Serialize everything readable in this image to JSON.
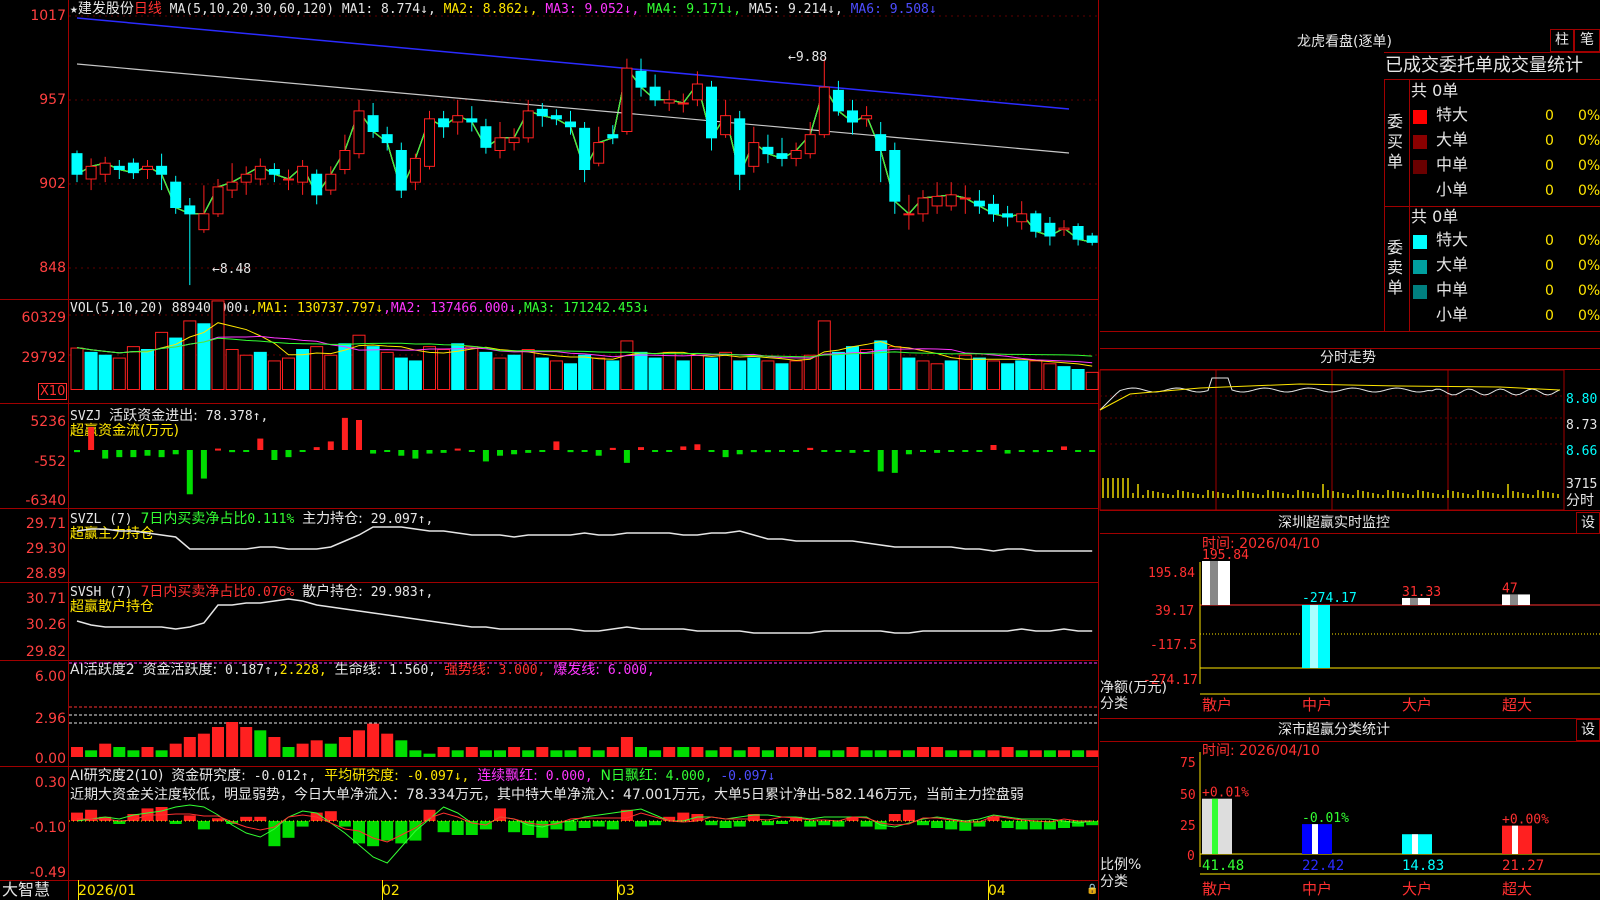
{
  "header": {
    "star": "★",
    "stock": "建发股份",
    "period": "日线",
    "ma_title": "MA(5,10,20,30,60,120)",
    "ma": [
      {
        "label": "MA1:",
        "value": "8.774↓",
        "color": "#e6e6e6"
      },
      {
        "label": "MA2:",
        "value": "8.862↓",
        "color": "#ffe600"
      },
      {
        "label": "MA3:",
        "value": "9.052↓",
        "color": "#ff36ff"
      },
      {
        "label": "MA4:",
        "value": "9.171↓",
        "color": "#33ff33"
      },
      {
        "label": "MA5:",
        "value": "9.214↓",
        "color": "#e6e6e6"
      },
      {
        "label": "MA6:",
        "value": "9.508↓",
        "color": "#4d4dff"
      }
    ]
  },
  "price_axis": [
    "1017",
    "957",
    "902",
    "848"
  ],
  "annotations": {
    "high": "9.88",
    "low": "8.48"
  },
  "vol": {
    "title": "VOL(5,10,20)",
    "value": "88940.000↓",
    "ma": [
      {
        "label": "MA1:",
        "value": "130737.797↓"
      },
      {
        "label": "MA2:",
        "value": "137466.000↓"
      },
      {
        "label": "MA3:",
        "value": "171242.453↓"
      }
    ],
    "axis": [
      "60329",
      "29792"
    ],
    "unit": "X10"
  },
  "svzj": {
    "title": "SVZJ",
    "label": "活跃资金进出:",
    "value": "78.378↑,",
    "sub": "超赢资金流(万元)",
    "axis": [
      "5236",
      "-552",
      "-6340"
    ]
  },
  "svzl": {
    "title": "SVZL (7)",
    "pct_label": "7日内买卖净占比",
    "pct_value": "0.111%",
    "hold_label": "主力持仓:",
    "hold_value": "29.097↑,",
    "sub": "超赢主力持仓",
    "axis": [
      "29.71",
      "29.30",
      "28.89"
    ]
  },
  "svsh": {
    "title": "SVSH (7)",
    "pct_label": "7日内买卖净占比",
    "pct_value": "0.076%",
    "hold_label": "散户持仓:",
    "hold_value": "29.983↑,",
    "sub": "超赢散户持仓",
    "axis": [
      "30.71",
      "30.26",
      "29.82"
    ]
  },
  "ai1": {
    "title": "AI活跃度2",
    "l1": "资金活跃度:",
    "v1": "0.187↑,",
    "v2": "2.228,",
    "l3": "生命线:",
    "v3": "1.560,",
    "l4": "强势线:",
    "v4": "3.000,",
    "l5": "爆发线:",
    "v5": "6.000,",
    "axis": [
      "6.00",
      "2.96",
      "0.00"
    ]
  },
  "ai2": {
    "title": "AI研究度2(10)",
    "l1": "资金研究度:",
    "v1": "-0.012↑,",
    "l2": "平均研究度:",
    "v2": "-0.097↓,",
    "l3": "连续飘红:",
    "v3": "0.000,",
    "l4": "N日飘红:",
    "v4": "4.000,",
    "v5": "-0.097↓",
    "note": "近期大资金关注度较低，明显弱势，今日大单净流入：78.334万元，其中特大单净流入：47.001万元，大单5日累计净出-582.146万元，当前主力控盘弱",
    "axis": [
      "0.30",
      "-0.10",
      "-0.49"
    ]
  },
  "xaxis": [
    "2026/01",
    "02",
    "03",
    "04"
  ],
  "brand": "大智慧",
  "right": {
    "dragon": {
      "title": "龙虎看盘(逐单)",
      "btn1": "柱",
      "btn2": "笔",
      "tabs": "已成交委托单成交量统计",
      "buy": {
        "side": "委买单",
        "total": "共 0单",
        "rows": [
          {
            "label": "特大",
            "count": "0",
            "pct": "0%",
            "color": "#ff0000"
          },
          {
            "label": "大单",
            "count": "0",
            "pct": "0%",
            "color": "#8a0000"
          },
          {
            "label": "中单",
            "count": "0",
            "pct": "0%",
            "color": "#6a0000"
          },
          {
            "label": "小单",
            "count": "0",
            "pct": "0%",
            "color": ""
          }
        ]
      },
      "sell": {
        "side": "委卖单",
        "total": "共 0单",
        "rows": [
          {
            "label": "特大",
            "count": "0",
            "pct": "0%",
            "color": "#00ffff"
          },
          {
            "label": "大单",
            "count": "0",
            "pct": "0%",
            "color": "#00a0a0"
          },
          {
            "label": "中单",
            "count": "0",
            "pct": "0%",
            "color": "#008080"
          },
          {
            "label": "小单",
            "count": "0",
            "pct": "0%",
            "color": ""
          }
        ]
      }
    },
    "intraday": {
      "title": "分时走势",
      "axis": [
        "8.80",
        "8.73",
        "8.66"
      ],
      "vol_label": "3715",
      "fen": "分时"
    },
    "monitor": {
      "title": "深圳超赢实时监控",
      "btn": "设",
      "time": "时间: 2026/04/10",
      "axis": [
        "195.84",
        "39.17",
        "-117.5",
        "-274.17"
      ],
      "ylabel1": "净额(万元)",
      "ylabel2": "分类",
      "bars": [
        {
          "label": "散户",
          "value": "195.84"
        },
        {
          "label": "中户",
          "value": "-274.17"
        },
        {
          "label": "大户",
          "value": "31.33"
        },
        {
          "label": "超大",
          "value": "47"
        }
      ]
    },
    "classify": {
      "title": "深市超赢分类统计",
      "btn": "设",
      "time": "时间: 2026/04/10",
      "axis": [
        "75",
        "50",
        "25",
        "0"
      ],
      "ylabel1": "比例%",
      "ylabel2": "分类",
      "bars": [
        {
          "label": "散户",
          "value": "41.48",
          "pct": "+0.01%"
        },
        {
          "label": "中户",
          "value": "22.42",
          "pct": "-0.01%"
        },
        {
          "label": "大户",
          "value": "14.83",
          "pct": ""
        },
        {
          "label": "超大",
          "value": "21.27",
          "pct": "+0.00%"
        }
      ]
    }
  },
  "chart_data": [
    {
      "type": "candlestick",
      "title": "建发股份 日线",
      "ylim": [
        8.4,
        10.2
      ],
      "x_start": "2026/01",
      "candles": [
        [
          9.28,
          9.15,
          9.3,
          9.1
        ],
        [
          9.12,
          9.2,
          9.25,
          9.05
        ],
        [
          9.15,
          9.22,
          9.26,
          9.1
        ],
        [
          9.2,
          9.18,
          9.24,
          9.12
        ],
        [
          9.22,
          9.16,
          9.25,
          9.12
        ],
        [
          9.18,
          9.2,
          9.24,
          9.12
        ],
        [
          9.2,
          9.15,
          9.28,
          9.05
        ],
        [
          9.1,
          8.94,
          9.14,
          8.9
        ],
        [
          8.95,
          8.9,
          9.0,
          8.45
        ],
        [
          8.8,
          8.9,
          9.08,
          8.78
        ],
        [
          8.9,
          9.07,
          9.12,
          8.88
        ],
        [
          9.05,
          9.1,
          9.22,
          9.0
        ],
        [
          9.1,
          9.15,
          9.2,
          9.02
        ],
        [
          9.12,
          9.2,
          9.25,
          9.08
        ],
        [
          9.18,
          9.15,
          9.22,
          9.1
        ],
        [
          9.12,
          9.12,
          9.18,
          9.05
        ],
        [
          9.1,
          9.2,
          9.24,
          9.02
        ],
        [
          9.15,
          9.02,
          9.18,
          8.96
        ],
        [
          9.05,
          9.15,
          9.2,
          9.02
        ],
        [
          9.18,
          9.3,
          9.4,
          9.15
        ],
        [
          9.28,
          9.55,
          9.62,
          9.25
        ],
        [
          9.52,
          9.42,
          9.6,
          9.38
        ],
        [
          9.4,
          9.35,
          9.45,
          9.3
        ],
        [
          9.3,
          9.05,
          9.35,
          9.0
        ],
        [
          9.1,
          9.25,
          9.28,
          9.05
        ],
        [
          9.2,
          9.5,
          9.55,
          9.18
        ],
        [
          9.5,
          9.45,
          9.55,
          9.38
        ],
        [
          9.48,
          9.52,
          9.62,
          9.4
        ],
        [
          9.5,
          9.48,
          9.58,
          9.42
        ],
        [
          9.45,
          9.32,
          9.5,
          9.28
        ],
        [
          9.3,
          9.38,
          9.48,
          9.25
        ],
        [
          9.35,
          9.38,
          9.44,
          9.3
        ],
        [
          9.38,
          9.55,
          9.62,
          9.35
        ],
        [
          9.56,
          9.52,
          9.6,
          9.45
        ],
        [
          9.52,
          9.5,
          9.56,
          9.46
        ],
        [
          9.48,
          9.45,
          9.55,
          9.4
        ],
        [
          9.44,
          9.18,
          9.48,
          9.1
        ],
        [
          9.22,
          9.35,
          9.45,
          9.2
        ],
        [
          9.4,
          9.38,
          9.46,
          9.34
        ],
        [
          9.42,
          9.82,
          9.88,
          9.4
        ],
        [
          9.8,
          9.7,
          9.88,
          9.64
        ],
        [
          9.7,
          9.62,
          9.78,
          9.58
        ],
        [
          9.6,
          9.62,
          9.68,
          9.55
        ],
        [
          9.6,
          9.6,
          9.66,
          9.54
        ],
        [
          9.62,
          9.72,
          9.8,
          9.58
        ],
        [
          9.7,
          9.38,
          9.74,
          9.3
        ],
        [
          9.4,
          9.52,
          9.62,
          9.38
        ],
        [
          9.5,
          9.15,
          9.55,
          9.05
        ],
        [
          9.2,
          9.35,
          9.45,
          9.16
        ],
        [
          9.32,
          9.28,
          9.4,
          9.22
        ],
        [
          9.28,
          9.25,
          9.38,
          9.2
        ],
        [
          9.25,
          9.3,
          9.35,
          9.2
        ],
        [
          9.28,
          9.4,
          9.48,
          9.25
        ],
        [
          9.4,
          9.7,
          9.88,
          9.38
        ],
        [
          9.68,
          9.55,
          9.74,
          9.52
        ],
        [
          9.55,
          9.48,
          9.62,
          9.4
        ],
        [
          9.5,
          9.52,
          9.58,
          9.45
        ],
        [
          9.4,
          9.3,
          9.48,
          9.1
        ],
        [
          9.3,
          8.98,
          9.35,
          8.9
        ],
        [
          8.9,
          8.9,
          9.02,
          8.8
        ],
        [
          8.9,
          9.0,
          9.05,
          8.85
        ],
        [
          8.95,
          9.01,
          9.1,
          8.9
        ],
        [
          8.95,
          9.02,
          9.1,
          8.92
        ],
        [
          9.0,
          9.0,
          9.08,
          8.9
        ],
        [
          8.98,
          8.95,
          9.05,
          8.9
        ],
        [
          8.96,
          8.9,
          9.02,
          8.85
        ],
        [
          8.9,
          8.88,
          8.95,
          8.82
        ],
        [
          8.85,
          8.9,
          8.98,
          8.8
        ],
        [
          8.9,
          8.79,
          8.92,
          8.75
        ],
        [
          8.84,
          8.76,
          8.88,
          8.7
        ],
        [
          8.8,
          8.81,
          8.86,
          8.76
        ],
        [
          8.82,
          8.74,
          8.84,
          8.7
        ],
        [
          8.76,
          8.72,
          8.78,
          8.7
        ]
      ]
    },
    {
      "type": "bar",
      "title": "VOL",
      "ylim": [
        0,
        70000
      ],
      "values": [
        29000,
        26000,
        24000,
        22000,
        30000,
        28000,
        40000,
        36000,
        48000,
        46000,
        62000,
        28000,
        24000,
        26000,
        20000,
        22000,
        28000,
        30000,
        24000,
        32000,
        38000,
        30000,
        26000,
        22000,
        20000,
        30000,
        28000,
        32000,
        30000,
        26000,
        22000,
        24000,
        28000,
        22000,
        20000,
        18000,
        24000,
        22000,
        20000,
        34000,
        26000,
        22000,
        26000,
        20000,
        24000,
        22000,
        26000,
        20000,
        22000,
        20000,
        18000,
        20000,
        24000,
        48000,
        26000,
        30000,
        28000,
        34000,
        30000,
        22000,
        20000,
        18000,
        20000,
        24000,
        22000,
        20000,
        18000,
        20000,
        20000,
        18000,
        16000,
        14000,
        12000
      ],
      "types": [
        1,
        0,
        0,
        1,
        1,
        0,
        1,
        0,
        1,
        0,
        1,
        1,
        1,
        0,
        1,
        1,
        0,
        1,
        1,
        0,
        1,
        0,
        1,
        0,
        0,
        1,
        1,
        0,
        1,
        0,
        1,
        0,
        1,
        0,
        1,
        0,
        0,
        1,
        0,
        1,
        0,
        0,
        1,
        0,
        1,
        0,
        1,
        0,
        0,
        1,
        0,
        1,
        1,
        1,
        0,
        0,
        1,
        0,
        1,
        0,
        1,
        1,
        0,
        1,
        0,
        1,
        0,
        0,
        1,
        1,
        0,
        0,
        1
      ]
    },
    {
      "type": "bar",
      "title": "SVZJ",
      "ylim": [
        -6340,
        5236
      ],
      "values": [
        -300,
        3200,
        -1200,
        -1000,
        -1000,
        -800,
        -1000,
        -600,
        -6200,
        -4000,
        200,
        -300,
        -100,
        1600,
        -1400,
        -1000,
        -200,
        400,
        1200,
        4500,
        4200,
        -500,
        -200,
        -800,
        -1200,
        -500,
        -400,
        200,
        -200,
        -1600,
        -800,
        -600,
        -400,
        -200,
        1200,
        -300,
        -200,
        -800,
        300,
        -1800,
        400,
        -100,
        -200,
        500,
        800,
        -200,
        -1000,
        -600,
        -300,
        -300,
        -200,
        -200,
        300,
        -200,
        -200,
        -400,
        -200,
        -3000,
        -3200,
        -600,
        -200,
        -400,
        -200,
        -100,
        -200,
        700,
        -500,
        -200,
        -300,
        -200,
        500,
        -200,
        -100
      ],
      "axis": [
        "5236",
        "-552",
        "-6340"
      ]
    },
    {
      "type": "line",
      "title": "SVZL",
      "ylim": [
        28.89,
        29.71
      ],
      "axis": [
        "29.71",
        "29.30",
        "28.89"
      ]
    },
    {
      "type": "line",
      "title": "SVSH",
      "ylim": [
        29.82,
        30.71
      ],
      "axis": [
        "30.71",
        "30.26",
        "29.82"
      ]
    },
    {
      "type": "bar",
      "title": "AI活跃度2",
      "ylim": [
        0,
        6
      ],
      "axis": [
        "6.00",
        "2.96",
        "0.00"
      ]
    },
    {
      "type": "bar",
      "title": "AI研究度2",
      "ylim": [
        -0.49,
        0.3
      ],
      "axis": [
        "0.30",
        "-0.10",
        "-0.49"
      ]
    }
  ]
}
